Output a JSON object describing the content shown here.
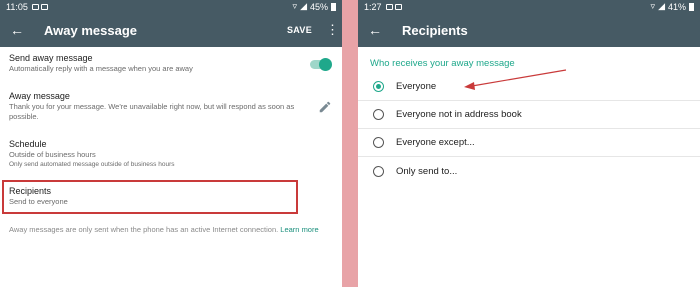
{
  "left": {
    "status": {
      "time": "11:05",
      "battery": "45%"
    },
    "appbar": {
      "back_icon": "arrow-left-icon",
      "title": "Away message",
      "save_label": "SAVE",
      "menu_icon": "more-vert-icon"
    },
    "send": {
      "label": "Send away message",
      "sub": "Automatically reply with a message when you are away",
      "enabled": true
    },
    "away": {
      "label": "Away message",
      "sub": "Thank you for your message. We're unavailable right now, but will respond as soon as possible.",
      "edit_icon": "pencil-icon"
    },
    "schedule": {
      "label": "Schedule",
      "sub": "Outside of business hours",
      "sub2": "Only send automated message outside of business hours"
    },
    "recipients": {
      "label": "Recipients",
      "sub": "Send to everyone"
    },
    "footnote": {
      "text": "Away messages are only sent when the phone has an active Internet connection.",
      "link": "Learn more"
    }
  },
  "right": {
    "status": {
      "time": "1:27",
      "battery": "41%"
    },
    "appbar": {
      "back_icon": "arrow-left-icon",
      "title": "Recipients"
    },
    "section": "Who receives your away message",
    "options": [
      {
        "label": "Everyone",
        "selected": true
      },
      {
        "label": "Everyone not in address book",
        "selected": false
      },
      {
        "label": "Everyone except...",
        "selected": false
      },
      {
        "label": "Only send to...",
        "selected": false
      }
    ]
  },
  "colors": {
    "appbar": "#465a64",
    "accent": "#1fa88b",
    "highlight": "#c93a3a",
    "divider": "#e8a3a7"
  }
}
